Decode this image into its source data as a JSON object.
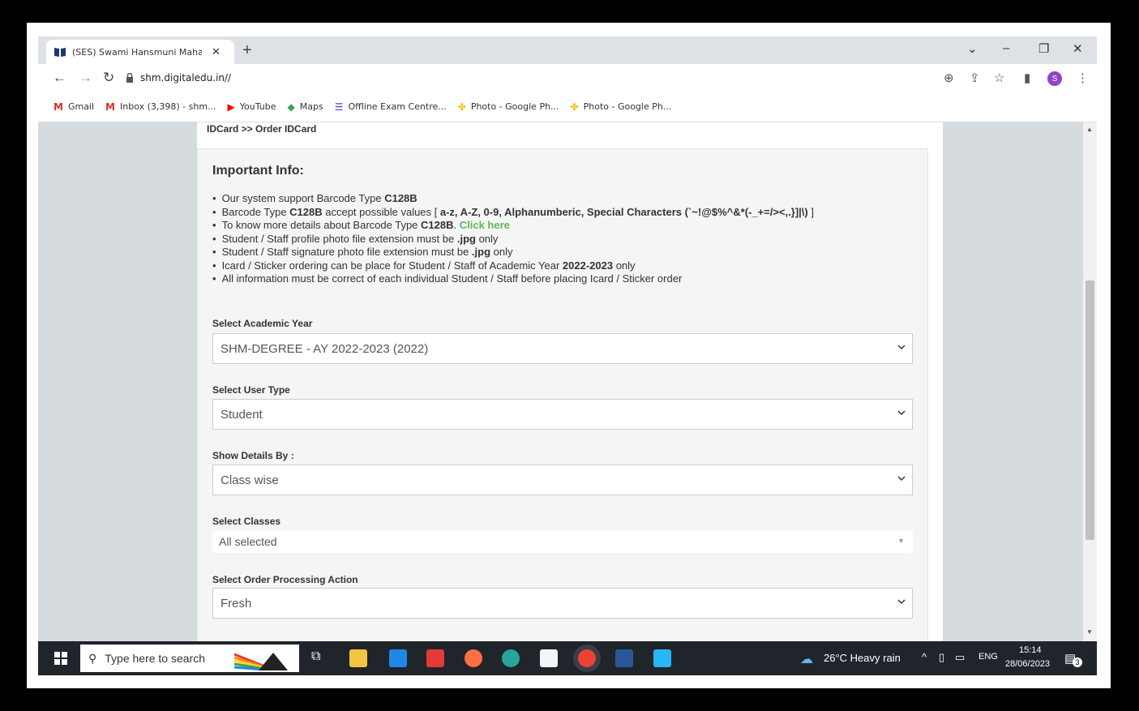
{
  "browser": {
    "tab_title": "(SES) Swami Hansmuni Maharaj D",
    "url": "shm.digitaledu.in//",
    "bookmarks": [
      {
        "label": "Gmail",
        "icon": "gmail-icon",
        "color": "#d93025"
      },
      {
        "label": "Inbox (3,398) - shm...",
        "icon": "gmail-icon",
        "color": "#d93025"
      },
      {
        "label": "YouTube",
        "icon": "youtube-icon",
        "color": "#ff0000"
      },
      {
        "label": "Maps",
        "icon": "maps-icon",
        "color": "#34a853"
      },
      {
        "label": "Offline Exam Centre...",
        "icon": "forms-icon",
        "color": "#673ab7"
      },
      {
        "label": "Photo - Google Ph...",
        "icon": "photos-icon",
        "color": "#fbbc04"
      },
      {
        "label": "Photo - Google Ph...",
        "icon": "photos-icon",
        "color": "#fbbc04"
      }
    ],
    "profile_initial": "S"
  },
  "page": {
    "breadcrumb": "IDCard >> Order IDCard",
    "info_title": "Important Info:",
    "info": {
      "l1_pre": "Our system support Barcode Type ",
      "l1_bold": "C128B",
      "l2_pre": "Barcode Type ",
      "l2_bold": "C128B",
      "l2_mid": " accept possible values [ ",
      "l2_vals": "a-z, A-Z, 0-9, Alphanumberic, Special Characters (`~!@$%^&*(-_+=/><,.}]|\\)",
      "l2_end": " ]",
      "l3_pre": "To know more details about Barcode Type ",
      "l3_bold": "C128B",
      "l3_dot": ". ",
      "l3_link": "Click here",
      "l4_pre": "Student / Staff profile photo file extension must be ",
      "l4_bold": ".jpg",
      "l4_end": " only",
      "l5_pre": "Student / Staff signature photo file extension must be ",
      "l5_bold": ".jpg",
      "l5_end": " only",
      "l6_pre": "Icard / Sticker ordering can be place for Student / Staff of Academic Year ",
      "l6_bold": "2022-2023",
      "l6_end": " only",
      "l7": "All information must be correct of each individual Student / Staff before placing Icard / Sticker order"
    },
    "fields": {
      "academic_year_label": "Select Academic Year",
      "academic_year_value": "SHM-DEGREE - AY 2022-2023 (2022)",
      "user_type_label": "Select User Type",
      "user_type_value": "Student",
      "show_details_label": "Show Details By :",
      "show_details_value": "Class wise",
      "classes_label": "Select Classes",
      "classes_value": "All selected",
      "order_action_label": "Select Order Processing Action",
      "order_action_value": "Fresh"
    }
  },
  "taskbar": {
    "search_placeholder": "Type here to search",
    "weather": "26°C  Heavy rain",
    "lang": "ENG",
    "time": "15:14",
    "date": "28/06/2023",
    "notifications": "3"
  },
  "colors": {
    "link_green": "#5cb85c",
    "taskbar_bg": "#20242b",
    "page_bg": "#d6dbdf"
  }
}
